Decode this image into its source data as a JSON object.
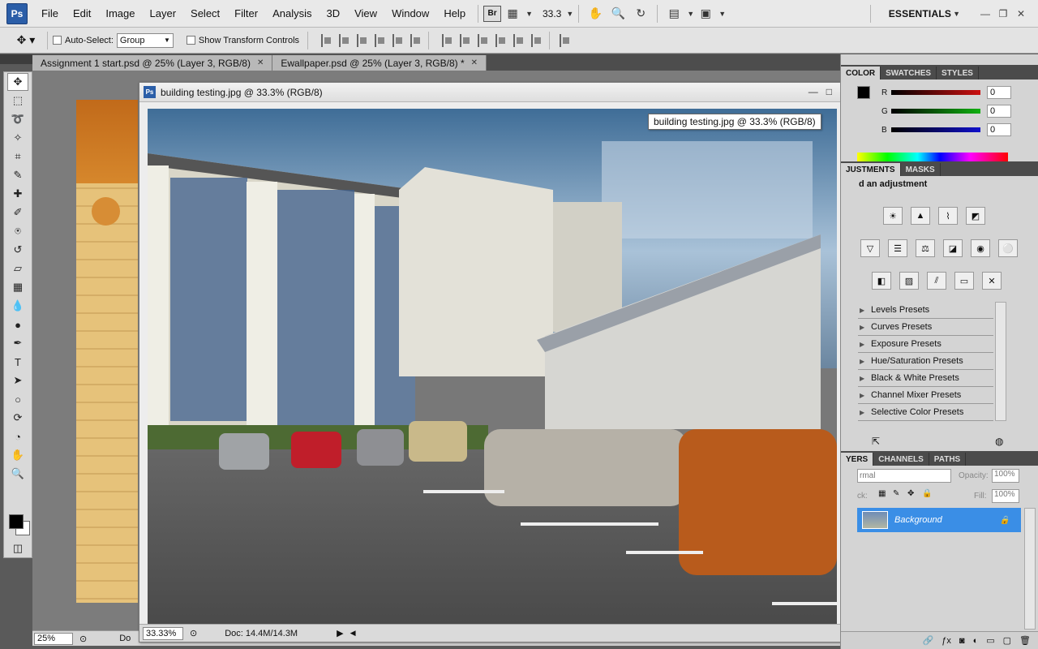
{
  "menubar": {
    "logo": "Ps",
    "items": [
      "File",
      "Edit",
      "Image",
      "Layer",
      "Select",
      "Filter",
      "Analysis",
      "3D",
      "View",
      "Window",
      "Help"
    ],
    "bridge_label": "Br",
    "zoom_value": "33.3",
    "workspace": "ESSENTIALS"
  },
  "options": {
    "auto_select_label": "Auto-Select:",
    "auto_select_value": "Group",
    "show_transform_label": "Show Transform Controls"
  },
  "tabs": [
    {
      "label": "Assignment 1 start.psd @ 25% (Layer 3, RGB/8)"
    },
    {
      "label": "Ewallpaper.psd @ 25% (Layer 3, RGB/8) *"
    }
  ],
  "bg_status": {
    "zoom": "25%",
    "doc_prefix": "Do"
  },
  "float_window": {
    "title": "building testing.jpg @ 33.3% (RGB/8)",
    "tooltip": "building testing.jpg @ 33.3% (RGB/8)",
    "status_zoom": "33.33%",
    "status_doc": "Doc: 14.4M/14.3M"
  },
  "color_panel": {
    "tabs": [
      "COLOR",
      "SWATCHES",
      "STYLES"
    ],
    "sliders": [
      {
        "label": "R",
        "value": "0",
        "color": "#cc1010"
      },
      {
        "label": "G",
        "value": "0",
        "color": "#10b010"
      },
      {
        "label": "B",
        "value": "0",
        "color": "#1010cc"
      }
    ]
  },
  "adjustments_panel": {
    "tabs": [
      "JUSTMENTS",
      "MASKS"
    ],
    "heading": "d an adjustment",
    "presets": [
      "Levels Presets",
      "Curves Presets",
      "Exposure Presets",
      "Hue/Saturation Presets",
      "Black & White Presets",
      "Channel Mixer Presets",
      "Selective Color Presets"
    ]
  },
  "layers_panel": {
    "tabs": [
      "YERS",
      "CHANNELS",
      "PATHS"
    ],
    "blend_mode": "rmal",
    "opacity_label": "Opacity:",
    "opacity_value": "100%",
    "lock_label": "ck:",
    "fill_label": "Fill:",
    "fill_value": "100%",
    "layer_name": "Background"
  }
}
